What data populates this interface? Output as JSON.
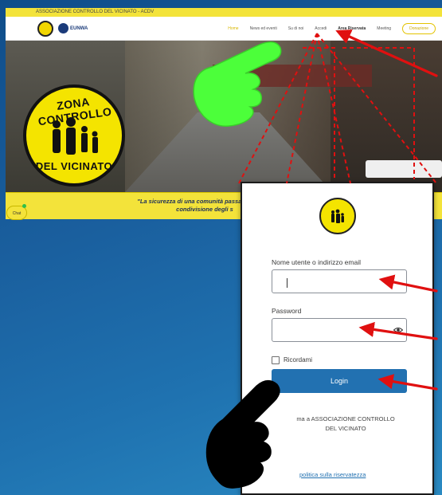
{
  "site": {
    "topbar_text": "ASSOCIAZIONE CONTROLLO DEL VICINATO - ACDV",
    "eunwa_label": "EUNWA",
    "nav": {
      "home": "Home",
      "news": "News ed eventi",
      "about": "Su di noi",
      "access": "Accedi",
      "reserved": "Area Riservata",
      "meeting": "Meeting",
      "donate": "Donazione"
    },
    "badge": {
      "top_text": "ZONA CONTROLLO",
      "bottom_text": "DEL VICINATO"
    },
    "quote": "\"La sicurezza di una comunità passa attraverso la condivisione degli s",
    "quote_line1": "\"La sicurezza di una comunità passa attraverso",
    "quote_line2": "condivisione degli s",
    "chat_label": "Chat"
  },
  "login": {
    "username_label": "Nome utente o indirizzo email",
    "username_value": "",
    "password_label": "Password",
    "password_value": "",
    "remember_label": "Ricordami",
    "login_button": "Login",
    "back_link_line1": "ma a ASSOCIAZIONE CONTROLLO",
    "back_link_line2": "DEL VICINATO",
    "privacy_link": "politica sulla riservatezza"
  },
  "colors": {
    "background": "#1a5f9e",
    "brand_yellow": "#f3e33a",
    "login_blue": "#2271b1",
    "arrow_red": "#e01010",
    "hand_green": "#4cff3a"
  },
  "icons": {
    "eye": "eye-icon",
    "pointing_hand_green": "pointing-hand-icon",
    "pointing_hand_black": "pointing-hand-icon"
  }
}
